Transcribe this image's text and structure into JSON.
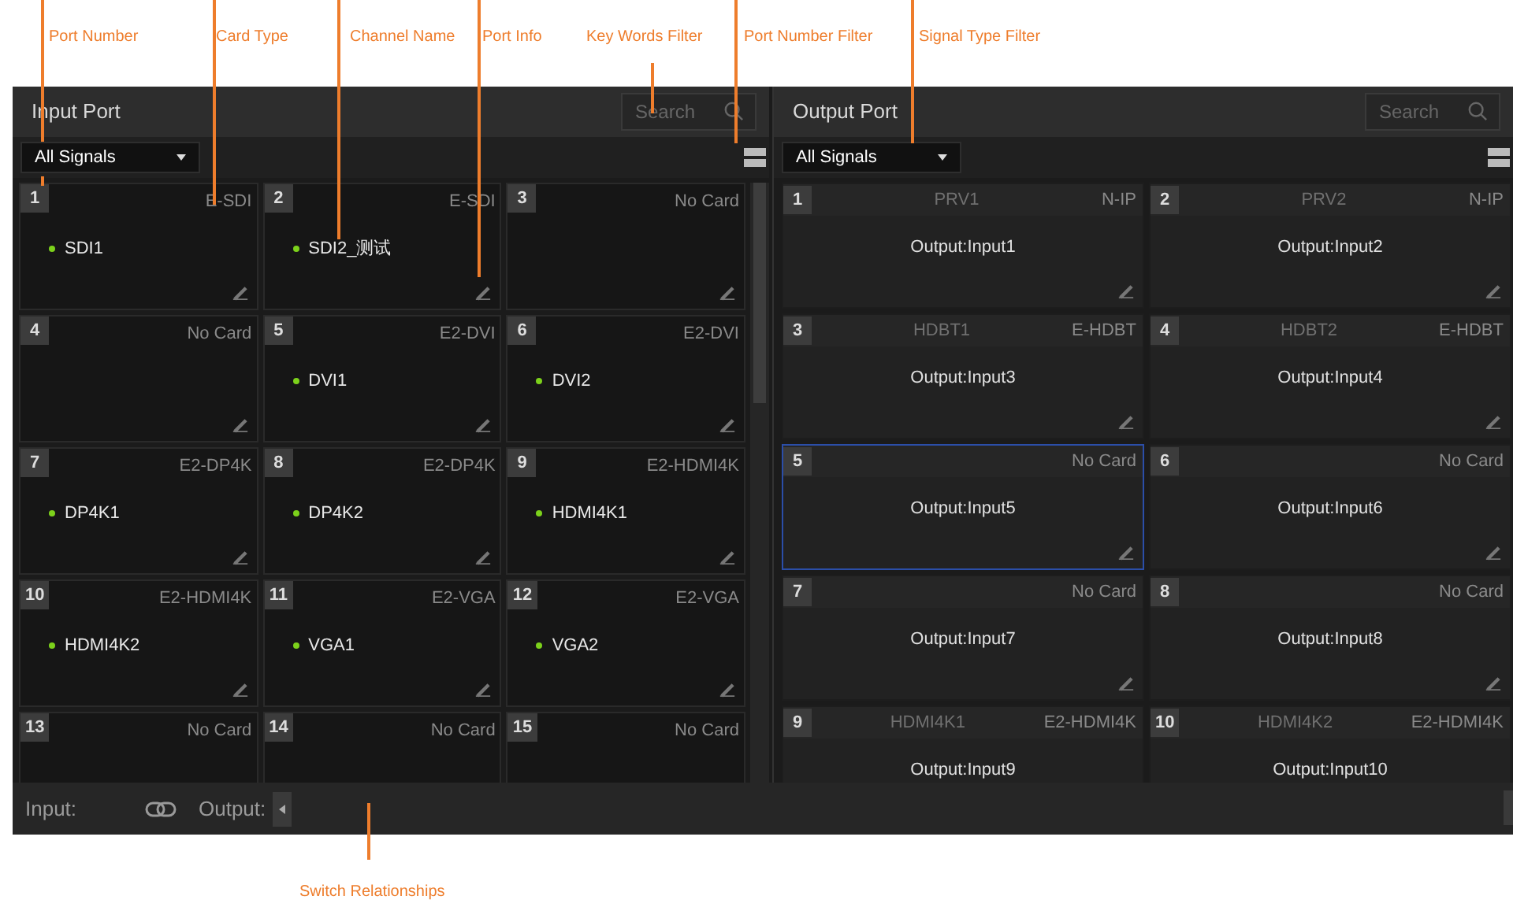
{
  "annotations": [
    {
      "label": "Port Number"
    },
    {
      "label": "Card Type"
    },
    {
      "label": "Channel Name"
    },
    {
      "label": "Port Info"
    },
    {
      "label": "Key Words Filter"
    },
    {
      "label": "Port Number Filter"
    },
    {
      "label": "Signal Type Filter"
    },
    {
      "label": "Switch Relationships"
    }
  ],
  "input_panel": {
    "title": "Input Port",
    "search": {
      "placeholder": "Search"
    },
    "signal_filter": "All Signals",
    "ports": [
      {
        "number": "1",
        "card_type": "E-SDI",
        "channel": "SDI1",
        "edit": true
      },
      {
        "number": "2",
        "card_type": "E-SDI",
        "channel": "SDI2_测试",
        "edit": true
      },
      {
        "number": "3",
        "card_type": "No Card",
        "edit": true
      },
      {
        "number": "4",
        "card_type": "No Card",
        "edit": true
      },
      {
        "number": "5",
        "card_type": "E2-DVI",
        "channel": "DVI1",
        "edit": true
      },
      {
        "number": "6",
        "card_type": "E2-DVI",
        "channel": "DVI2",
        "edit": true
      },
      {
        "number": "7",
        "card_type": "E2-DP4K",
        "channel": "DP4K1",
        "edit": true
      },
      {
        "number": "8",
        "card_type": "E2-DP4K",
        "channel": "DP4K2",
        "edit": true
      },
      {
        "number": "9",
        "card_type": "E2-HDMI4K",
        "channel": "HDMI4K1",
        "edit": true
      },
      {
        "number": "10",
        "card_type": "E2-HDMI4K",
        "channel": "HDMI4K2",
        "edit": true
      },
      {
        "number": "11",
        "card_type": "E2-VGA",
        "channel": "VGA1",
        "edit": true
      },
      {
        "number": "12",
        "card_type": "E2-VGA",
        "channel": "VGA2",
        "edit": true
      },
      {
        "number": "13",
        "card_type": "No Card",
        "edit": false
      },
      {
        "number": "14",
        "card_type": "No Card",
        "edit": false
      },
      {
        "number": "15",
        "card_type": "No Card",
        "edit": false
      }
    ]
  },
  "output_panel": {
    "title": "Output Port",
    "search": {
      "placeholder": "Search"
    },
    "signal_filter": "All Signals",
    "ports": [
      {
        "number": "1",
        "source": "PRV1",
        "card_type": "N-IP",
        "output": "Output:Input1",
        "selected": false,
        "edit": true
      },
      {
        "number": "2",
        "source": "PRV2",
        "card_type": "N-IP",
        "output": "Output:Input2",
        "selected": false,
        "edit": true
      },
      {
        "number": "3",
        "source": "HDBT1",
        "card_type": "E-HDBT",
        "output": "Output:Input3",
        "selected": false,
        "edit": true
      },
      {
        "number": "4",
        "source": "HDBT2",
        "card_type": "E-HDBT",
        "output": "Output:Input4",
        "selected": false,
        "edit": true
      },
      {
        "number": "5",
        "card_type": "No Card",
        "output": "Output:Input5",
        "selected": true,
        "edit": true
      },
      {
        "number": "6",
        "card_type": "No Card",
        "output": "Output:Input6",
        "selected": false,
        "edit": true
      },
      {
        "number": "7",
        "card_type": "No Card",
        "output": "Output:Input7",
        "selected": false,
        "edit": true
      },
      {
        "number": "8",
        "card_type": "No Card",
        "output": "Output:Input8",
        "selected": false,
        "edit": true
      },
      {
        "number": "9",
        "source": "HDMI4K1",
        "card_type": "E2-HDMI4K",
        "output": "Output:Input9",
        "selected": false,
        "edit": false
      },
      {
        "number": "10",
        "source": "HDMI4K2",
        "card_type": "E2-HDMI4K",
        "output": "Output:Input10",
        "selected": false,
        "edit": false
      }
    ]
  },
  "switch_bar": {
    "input_label": "Input:",
    "output_label": "Output:"
  }
}
